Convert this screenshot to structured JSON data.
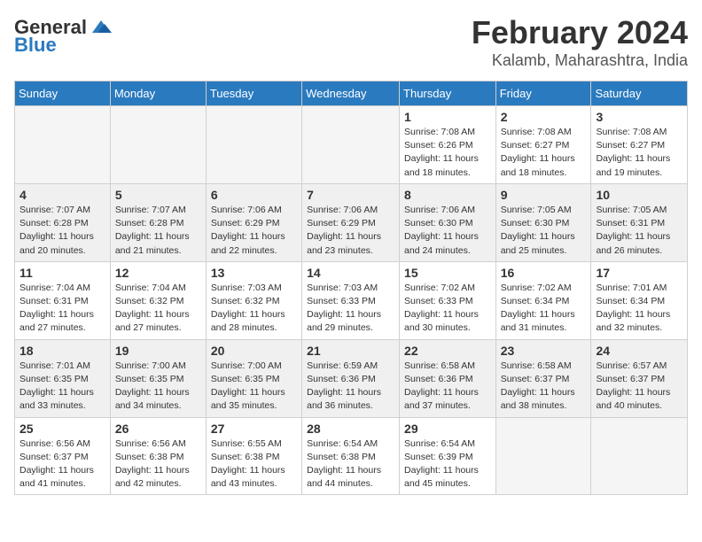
{
  "header": {
    "logo_line1": "General",
    "logo_line2": "Blue",
    "month": "February 2024",
    "location": "Kalamb, Maharashtra, India"
  },
  "days_of_week": [
    "Sunday",
    "Monday",
    "Tuesday",
    "Wednesday",
    "Thursday",
    "Friday",
    "Saturday"
  ],
  "weeks": [
    [
      {
        "day": "",
        "info": ""
      },
      {
        "day": "",
        "info": ""
      },
      {
        "day": "",
        "info": ""
      },
      {
        "day": "",
        "info": ""
      },
      {
        "day": "1",
        "info": "Sunrise: 7:08 AM\nSunset: 6:26 PM\nDaylight: 11 hours\nand 18 minutes."
      },
      {
        "day": "2",
        "info": "Sunrise: 7:08 AM\nSunset: 6:27 PM\nDaylight: 11 hours\nand 18 minutes."
      },
      {
        "day": "3",
        "info": "Sunrise: 7:08 AM\nSunset: 6:27 PM\nDaylight: 11 hours\nand 19 minutes."
      }
    ],
    [
      {
        "day": "4",
        "info": "Sunrise: 7:07 AM\nSunset: 6:28 PM\nDaylight: 11 hours\nand 20 minutes."
      },
      {
        "day": "5",
        "info": "Sunrise: 7:07 AM\nSunset: 6:28 PM\nDaylight: 11 hours\nand 21 minutes."
      },
      {
        "day": "6",
        "info": "Sunrise: 7:06 AM\nSunset: 6:29 PM\nDaylight: 11 hours\nand 22 minutes."
      },
      {
        "day": "7",
        "info": "Sunrise: 7:06 AM\nSunset: 6:29 PM\nDaylight: 11 hours\nand 23 minutes."
      },
      {
        "day": "8",
        "info": "Sunrise: 7:06 AM\nSunset: 6:30 PM\nDaylight: 11 hours\nand 24 minutes."
      },
      {
        "day": "9",
        "info": "Sunrise: 7:05 AM\nSunset: 6:30 PM\nDaylight: 11 hours\nand 25 minutes."
      },
      {
        "day": "10",
        "info": "Sunrise: 7:05 AM\nSunset: 6:31 PM\nDaylight: 11 hours\nand 26 minutes."
      }
    ],
    [
      {
        "day": "11",
        "info": "Sunrise: 7:04 AM\nSunset: 6:31 PM\nDaylight: 11 hours\nand 27 minutes."
      },
      {
        "day": "12",
        "info": "Sunrise: 7:04 AM\nSunset: 6:32 PM\nDaylight: 11 hours\nand 27 minutes."
      },
      {
        "day": "13",
        "info": "Sunrise: 7:03 AM\nSunset: 6:32 PM\nDaylight: 11 hours\nand 28 minutes."
      },
      {
        "day": "14",
        "info": "Sunrise: 7:03 AM\nSunset: 6:33 PM\nDaylight: 11 hours\nand 29 minutes."
      },
      {
        "day": "15",
        "info": "Sunrise: 7:02 AM\nSunset: 6:33 PM\nDaylight: 11 hours\nand 30 minutes."
      },
      {
        "day": "16",
        "info": "Sunrise: 7:02 AM\nSunset: 6:34 PM\nDaylight: 11 hours\nand 31 minutes."
      },
      {
        "day": "17",
        "info": "Sunrise: 7:01 AM\nSunset: 6:34 PM\nDaylight: 11 hours\nand 32 minutes."
      }
    ],
    [
      {
        "day": "18",
        "info": "Sunrise: 7:01 AM\nSunset: 6:35 PM\nDaylight: 11 hours\nand 33 minutes."
      },
      {
        "day": "19",
        "info": "Sunrise: 7:00 AM\nSunset: 6:35 PM\nDaylight: 11 hours\nand 34 minutes."
      },
      {
        "day": "20",
        "info": "Sunrise: 7:00 AM\nSunset: 6:35 PM\nDaylight: 11 hours\nand 35 minutes."
      },
      {
        "day": "21",
        "info": "Sunrise: 6:59 AM\nSunset: 6:36 PM\nDaylight: 11 hours\nand 36 minutes."
      },
      {
        "day": "22",
        "info": "Sunrise: 6:58 AM\nSunset: 6:36 PM\nDaylight: 11 hours\nand 37 minutes."
      },
      {
        "day": "23",
        "info": "Sunrise: 6:58 AM\nSunset: 6:37 PM\nDaylight: 11 hours\nand 38 minutes."
      },
      {
        "day": "24",
        "info": "Sunrise: 6:57 AM\nSunset: 6:37 PM\nDaylight: 11 hours\nand 40 minutes."
      }
    ],
    [
      {
        "day": "25",
        "info": "Sunrise: 6:56 AM\nSunset: 6:37 PM\nDaylight: 11 hours\nand 41 minutes."
      },
      {
        "day": "26",
        "info": "Sunrise: 6:56 AM\nSunset: 6:38 PM\nDaylight: 11 hours\nand 42 minutes."
      },
      {
        "day": "27",
        "info": "Sunrise: 6:55 AM\nSunset: 6:38 PM\nDaylight: 11 hours\nand 43 minutes."
      },
      {
        "day": "28",
        "info": "Sunrise: 6:54 AM\nSunset: 6:38 PM\nDaylight: 11 hours\nand 44 minutes."
      },
      {
        "day": "29",
        "info": "Sunrise: 6:54 AM\nSunset: 6:39 PM\nDaylight: 11 hours\nand 45 minutes."
      },
      {
        "day": "",
        "info": ""
      },
      {
        "day": "",
        "info": ""
      }
    ]
  ]
}
